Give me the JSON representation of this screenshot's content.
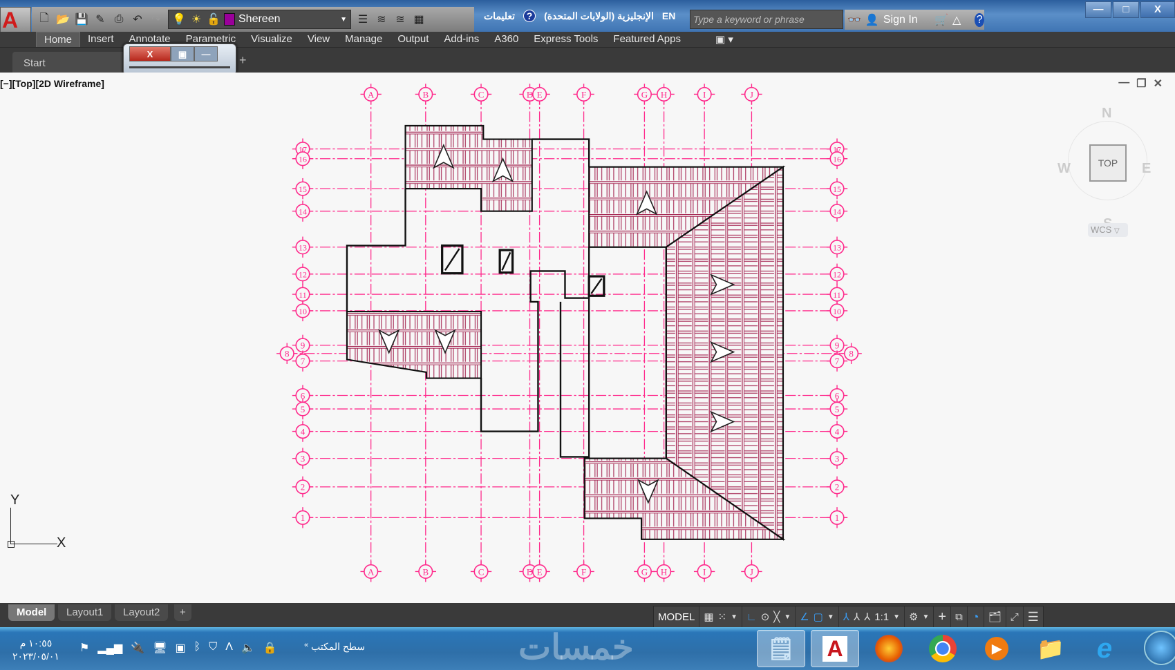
{
  "titlebar": {
    "app_button": "A",
    "layer_name": "Shereen",
    "layer_color": "#9a009a",
    "help_label": "تعليمات",
    "language": "الإنجليزية (الولايات المتحدة)",
    "language_code": "EN",
    "search_placeholder": "Type a keyword or phrase",
    "sign_in": "Sign In",
    "window_buttons": [
      "—",
      "□",
      "X"
    ]
  },
  "ribbon": {
    "tabs": [
      "Home",
      "Insert",
      "Annotate",
      "Parametric",
      "Visualize",
      "View",
      "Manage",
      "Output",
      "Add-ins",
      "A360",
      "Express Tools",
      "Featured Apps"
    ],
    "active": "Home"
  },
  "file_tabs": {
    "start": "Start",
    "add": "+"
  },
  "float_window": {
    "close": "X",
    "restore": "▣",
    "minimize": "—"
  },
  "viewport": {
    "label": "[−][Top][2D Wireframe]",
    "controls": [
      "—",
      "❐",
      "✕"
    ],
    "viewcube": {
      "n": "N",
      "s": "S",
      "e": "E",
      "w": "W",
      "face": "TOP",
      "wcs": "WCS"
    },
    "ucs": {
      "x": "X",
      "y": "Y"
    }
  },
  "drawing": {
    "grid_color": "#ff2a8c",
    "hatch_color": "#a3204e",
    "columns": [
      "A",
      "B",
      "C",
      "D",
      "E",
      "F",
      "G",
      "H",
      "I",
      "J"
    ],
    "rows": [
      "17",
      "16",
      "15",
      "14",
      "13",
      "12",
      "11",
      "10",
      "9",
      "8",
      "7",
      "6",
      "5",
      "4",
      "3",
      "2",
      "1"
    ]
  },
  "layout_tabs": {
    "tabs": [
      "Model",
      "Layout1",
      "Layout2"
    ],
    "active": "Model",
    "add": "+"
  },
  "status_bar": {
    "model": "MODEL",
    "scale": "1:1"
  },
  "taskbar": {
    "time": "١٠:٥٥ م",
    "date": "٢٠٢٣/٠٥/٠١",
    "desktop": "سطح المكتب",
    "watermark": "خمسات",
    "apps": [
      "notepad",
      "autocad",
      "firefox",
      "chrome",
      "media-player",
      "file-explorer",
      "internet-explorer"
    ]
  }
}
